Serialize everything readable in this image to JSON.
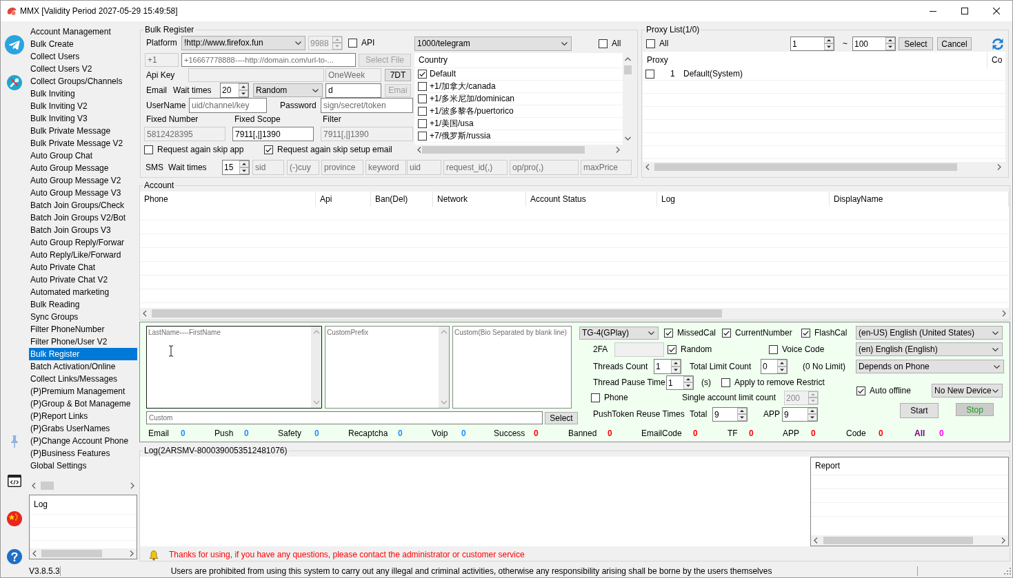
{
  "window": {
    "title": "MMX [Validity Period 2027-05-29 15:49:58]"
  },
  "menu": {
    "items": [
      {
        "label": "Account Management",
        "selected": false
      },
      {
        "label": "Bulk Create",
        "selected": false
      },
      {
        "label": "Collect Users",
        "selected": false
      },
      {
        "label": "Collect Users V2",
        "selected": false
      },
      {
        "label": "Collect Groups/Channels",
        "selected": false
      },
      {
        "label": "Bulk Inviting",
        "selected": false
      },
      {
        "label": "Bulk Inviting V2",
        "selected": false
      },
      {
        "label": "Bulk Inviting V3",
        "selected": false
      },
      {
        "label": "Bulk Private Message",
        "selected": false
      },
      {
        "label": "Bulk Private Message V2",
        "selected": false
      },
      {
        "label": "Auto Group Chat",
        "selected": false
      },
      {
        "label": "Auto Group Message",
        "selected": false
      },
      {
        "label": "Auto Group Message V2",
        "selected": false
      },
      {
        "label": "Auto Group Message V3",
        "selected": false
      },
      {
        "label": "Batch Join Groups/Check",
        "selected": false
      },
      {
        "label": "Batch Join Groups V2/Bot",
        "selected": false
      },
      {
        "label": "Batch Join Groups V3",
        "selected": false
      },
      {
        "label": "Auto Group Reply/Forwar",
        "selected": false
      },
      {
        "label": "Auto Reply/Like/Forward",
        "selected": false
      },
      {
        "label": "Auto Private Chat",
        "selected": false
      },
      {
        "label": "Auto Private Chat V2",
        "selected": false
      },
      {
        "label": "Automated marketing",
        "selected": false
      },
      {
        "label": "Bulk Reading",
        "selected": false
      },
      {
        "label": "Sync Groups",
        "selected": false
      },
      {
        "label": "Filter PhoneNumber",
        "selected": false
      },
      {
        "label": "Filter Phone/User V2",
        "selected": false
      },
      {
        "label": "Bulk Register",
        "selected": true
      },
      {
        "label": "Batch Activation/Online",
        "selected": false
      },
      {
        "label": "Collect Links/Messages",
        "selected": false
      },
      {
        "label": "(P)Premium Management",
        "selected": false
      },
      {
        "label": "(P)Group & Bot Manageme",
        "selected": false
      },
      {
        "label": "(P)Report Links",
        "selected": false
      },
      {
        "label": "(P)Grabs UserNames",
        "selected": false
      },
      {
        "label": "(P)Change Account Phone",
        "selected": false
      },
      {
        "label": "(P)Business Features",
        "selected": false
      },
      {
        "label": "Global Settings",
        "selected": false
      }
    ]
  },
  "sidebar_log": {
    "header": "Log"
  },
  "bulk_register": {
    "title": "Bulk Register",
    "platform_label": "Platform",
    "platform": {
      "value": "!http://www.firefox.fun"
    },
    "port": {
      "value": "9988",
      "disabled": true
    },
    "api": {
      "label": "API",
      "checked": false
    },
    "country_code": {
      "value": "+1",
      "disabled": true
    },
    "url": {
      "placeholder": "+16667778888----http://domain.com/url-to-..."
    },
    "select_file_button": {
      "label": "Select File",
      "disabled": true
    },
    "api_key_label": "Api Key",
    "api_key": {
      "disabled": true
    },
    "duration": {
      "value": "OneWeek",
      "disabled": true
    },
    "duration_button": {
      "label": "7DT",
      "disabled": false
    },
    "email_label": "Email",
    "email_wait_label": "Wait times",
    "email_wait": {
      "value": "20"
    },
    "email_mode": {
      "value": "Random"
    },
    "email_domain": {
      "value": "d"
    },
    "email_button": {
      "label": "Emai",
      "disabled": true
    },
    "username_label": "UserName",
    "username": {
      "placeholder": "uid/channel/key"
    },
    "password_label": "Password",
    "password": {
      "placeholder": "sign/secret/token"
    },
    "fixed_number_label": "Fixed Number",
    "fixed_scope_label": "Fixed Scope",
    "filter_label": "Filter",
    "fixed_number": {
      "value": "5812428395",
      "disabled": true
    },
    "fixed_scope": {
      "value": "7911[,|]1390",
      "disabled": false
    },
    "filter": {
      "value": "7911[,|]1390",
      "disabled": true
    },
    "skip_app": {
      "label": "Request again skip app",
      "checked": false
    },
    "skip_email": {
      "label": "Request again skip setup email",
      "checked": true
    },
    "sms_label": "SMS",
    "sms_wait_label": "Wait times",
    "sms_wait": {
      "value": "15"
    },
    "sms_fields": [
      {
        "placeholder": "sid",
        "disabled": true
      },
      {
        "placeholder": "(-)cuy",
        "disabled": true
      },
      {
        "placeholder": "province",
        "disabled": true
      },
      {
        "placeholder": "keyword",
        "disabled": true
      },
      {
        "placeholder": "uid",
        "disabled": true
      },
      {
        "placeholder": "request_id(,)",
        "disabled": true
      },
      {
        "placeholder": "op/pro(,)",
        "disabled": true
      },
      {
        "placeholder": "maxPrice",
        "disabled": true
      }
    ],
    "service": {
      "value": "1000/telegram"
    },
    "all": {
      "label": "All",
      "checked": false
    },
    "country_header": "Country",
    "countries": [
      {
        "label": "Default",
        "checked": true
      },
      {
        "label": "+1/加拿大/canada",
        "checked": false
      },
      {
        "label": "+1/多米尼加/dominican",
        "checked": false
      },
      {
        "label": "+1/波多黎各/puertorico",
        "checked": false
      },
      {
        "label": "+1/美国/usa",
        "checked": false
      },
      {
        "label": "+7/俄罗斯/russia",
        "checked": false
      }
    ]
  },
  "proxy_list": {
    "title": "Proxy List(1/0)",
    "all": {
      "label": "All",
      "checked": false
    },
    "range_from": {
      "value": "1"
    },
    "range_separator": "~",
    "range_to": {
      "value": "100"
    },
    "select_button": {
      "label": "Select"
    },
    "cancel_button": {
      "label": "Cancel"
    },
    "columns": [
      "Proxy",
      "Co"
    ],
    "rows": [
      {
        "checked": false,
        "index": "1",
        "proxy": "Default(System)"
      }
    ]
  },
  "account": {
    "title": "Account",
    "columns": [
      "Phone",
      "Api",
      "Ban(Del)",
      "Network",
      "Account Status",
      "Log",
      "DisplayName"
    ]
  },
  "register_panel": {
    "names_field": {
      "placeholder": "LastName----FirstName",
      "focused": true
    },
    "prefix_field": {
      "placeholder": "CustomPrefix",
      "focused": false
    },
    "bio_field": {
      "placeholder": "Custom(Bio Separated by blank line)",
      "focused": false
    },
    "custom_field": {
      "placeholder": "Custom"
    },
    "select_button": {
      "label": "Select"
    },
    "client": {
      "value": "TG-4(GPlay)"
    },
    "call_options": [
      {
        "label": "MissedCal",
        "checked": true
      },
      {
        "label": "CurrentNumber",
        "checked": true
      },
      {
        "label": "FlashCal",
        "checked": true
      }
    ],
    "twofa_label": "2FA",
    "twofa": {
      "disabled": true
    },
    "random": {
      "label": "Random",
      "checked": true
    },
    "voice_code": {
      "label": "Voice Code",
      "checked": false
    },
    "threads_label": "Threads Count",
    "threads": {
      "value": "1"
    },
    "total_limit_label": "Total Limit Count",
    "total_limit": {
      "value": "0"
    },
    "total_limit_hint": "(0 No Limit)",
    "pause_label": "Thread Pause Time",
    "pause": {
      "value": "1"
    },
    "pause_unit": "(s)",
    "remove_restrict": {
      "label": "Apply to remove Restrict",
      "checked": false
    },
    "phone": {
      "label": "Phone",
      "checked": false
    },
    "single_limit_label": "Single account limit count",
    "single_limit": {
      "value": "200",
      "disabled": true
    },
    "push_label": "PushToken Reuse Times",
    "push_total_label": "Total",
    "push_total": {
      "value": "9"
    },
    "push_app_label": "APP",
    "push_app": {
      "value": "9"
    },
    "language": {
      "value": "(en-US) English (United States)"
    },
    "system_language": {
      "value": "(en) English (English)"
    },
    "region": {
      "value": "Depends on Phone"
    },
    "auto_offline": {
      "label": "Auto offline",
      "checked": true
    },
    "device": {
      "value": "No New Device"
    },
    "start_button": {
      "label": "Start"
    },
    "stop_button": {
      "label": "Stop"
    },
    "stats": [
      {
        "kind": "count",
        "label": "Email",
        "value": "0",
        "color": "#1e90ff"
      },
      {
        "kind": "count",
        "label": "Push",
        "value": "0",
        "color": "#1e90ff"
      },
      {
        "kind": "count",
        "label": "Safety",
        "value": "0",
        "color": "#1e90ff"
      },
      {
        "kind": "count",
        "label": "Recaptcha",
        "value": "0",
        "color": "#1e90ff"
      },
      {
        "kind": "count",
        "label": "Voip",
        "value": "0",
        "color": "#1e90ff"
      },
      {
        "kind": "count",
        "label": "Success",
        "value": "0",
        "color": "#ff0000"
      },
      {
        "kind": "count",
        "label": "Banned",
        "value": "0",
        "color": "#ff0000"
      },
      {
        "kind": "count",
        "label": "EmailCode",
        "value": "0",
        "color": "#ff0000"
      },
      {
        "kind": "count",
        "label": "TF",
        "value": "0",
        "color": "#ff0000"
      },
      {
        "kind": "count",
        "label": "APP",
        "value": "0",
        "color": "#ff0000"
      },
      {
        "kind": "count",
        "label": "Code",
        "value": "0",
        "color": "#ff0000"
      },
      {
        "kind": "total",
        "label": "All",
        "value": "0",
        "color": "#ff00ff"
      }
    ]
  },
  "log": {
    "title": "Log(2ARSMV-8000390053512481076)",
    "report_header": "Report",
    "notice": "Thanks for using, if you have any questions, please contact the administrator or customer service"
  },
  "status_bar": {
    "version": "V3.8.5.3",
    "disclaimer": "Users are prohibited from using this system to carry out any illegal and criminal activities, otherwise any responsibility arising shall be borne by the users themselves"
  }
}
